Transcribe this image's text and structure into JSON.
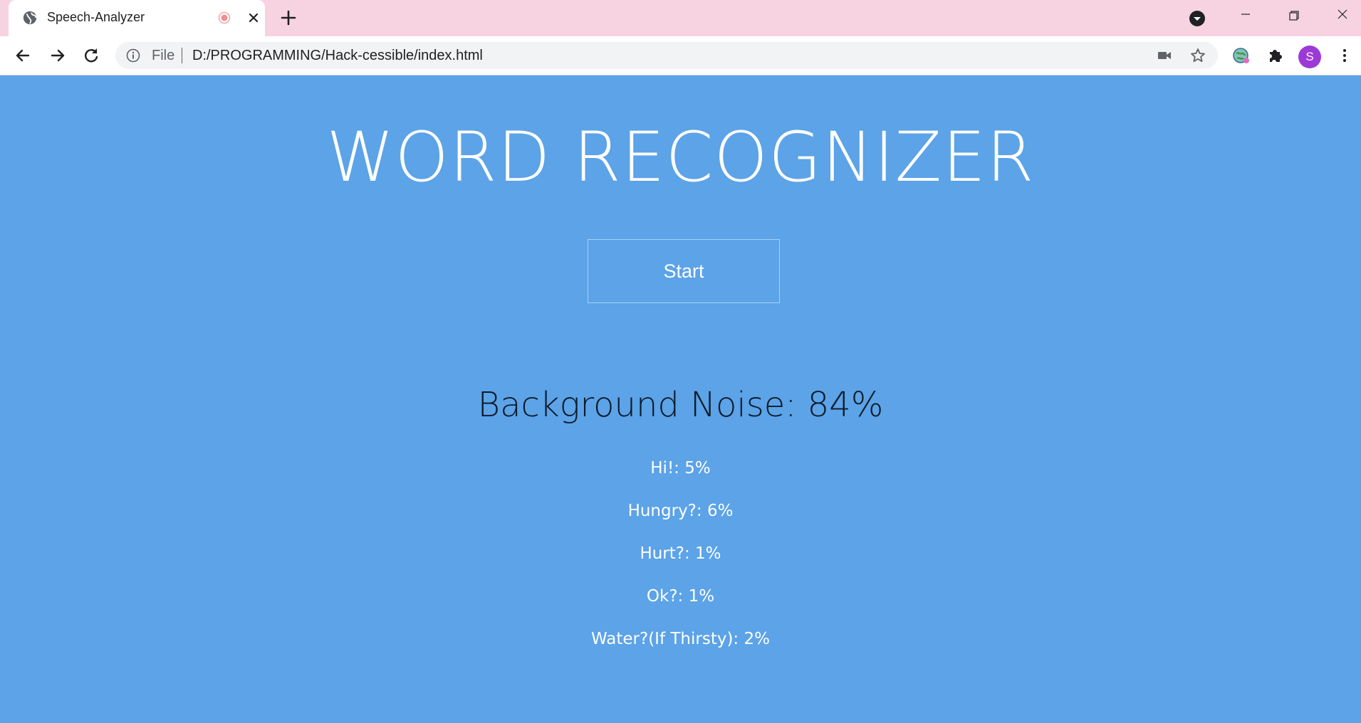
{
  "browser": {
    "tab": {
      "title": "Speech-Analyzer"
    },
    "omnibox": {
      "scheme_label": "File",
      "url": "D:/PROGRAMMING/Hack-cessible/index.html"
    },
    "profile": {
      "initial": "S",
      "color": "#9c3ad8"
    },
    "colors": {
      "tabstrip": "#f7d3e1",
      "toolbar": "#ffffff"
    }
  },
  "page": {
    "title": "WORD RECOGNIZER",
    "start_label": "Start",
    "noise": "Background Noise: 84%",
    "words": [
      "Hi!: 5%",
      "Hungry?: 6%",
      "Hurt?: 1%",
      "Ok?: 1%",
      "Water?(If Thirsty): 2%"
    ],
    "colors": {
      "background": "#5ca3e8",
      "text": "#ffffff",
      "noise_text": "#0d1b2a"
    }
  }
}
